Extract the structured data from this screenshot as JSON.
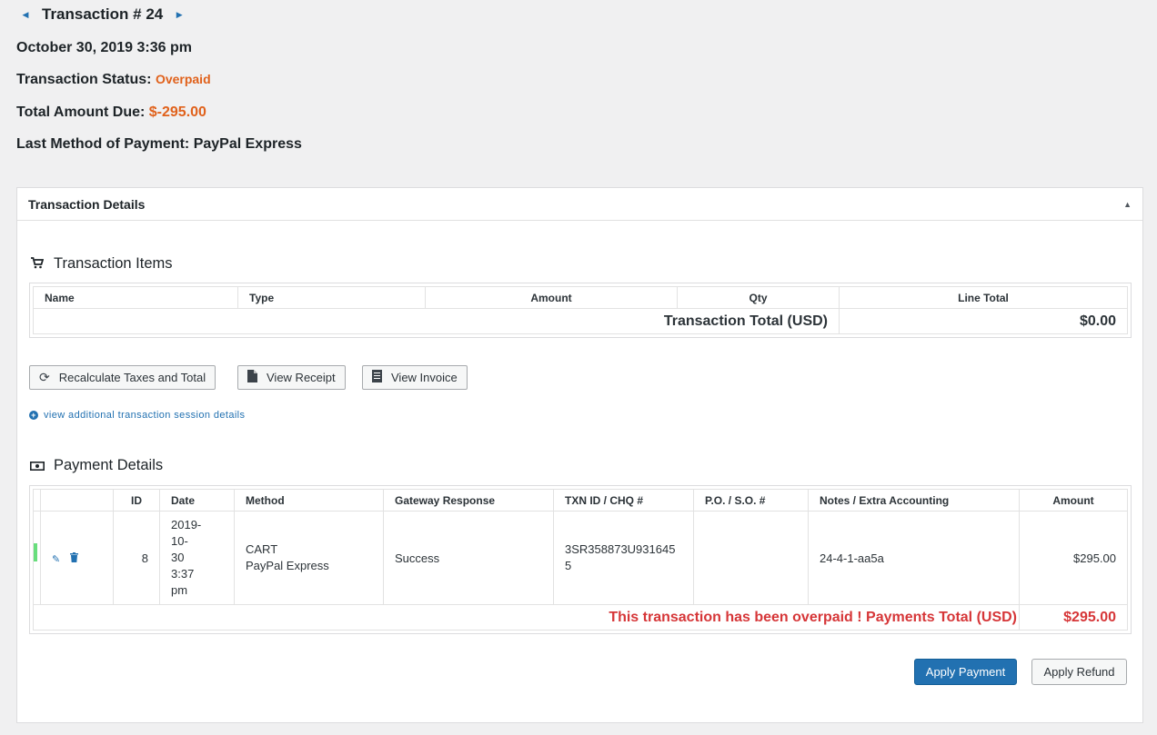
{
  "header": {
    "prev_icon": "triangle-left-icon",
    "next_icon": "triangle-right-icon",
    "title": "Transaction # 24",
    "date": "October 30, 2019 3:36 pm",
    "status_label": "Transaction Status:",
    "status_value": "Overpaid",
    "due_label": "Total Amount Due:",
    "due_value": "$-295.00",
    "method_label": "Last Method of Payment:",
    "method_value": "PayPal Express"
  },
  "panel": {
    "title": "Transaction Details",
    "collapse_icon": "triangle-up-icon"
  },
  "items": {
    "heading": "Transaction Items",
    "heading_icon": "cart-icon",
    "columns": [
      "Name",
      "Type",
      "Amount",
      "Qty",
      "Line Total"
    ],
    "total_label": "Transaction Total (USD)",
    "total_value": "$0.00"
  },
  "buttons": {
    "recalculate": "Recalculate Taxes and Total",
    "view_receipt": "View Receipt",
    "view_invoice": "View Invoice",
    "additional_link": "view additional transaction session details"
  },
  "payments": {
    "heading": "Payment Details",
    "heading_icon": "money-icon",
    "columns": [
      "ID",
      "Date",
      "Method",
      "Gateway Response",
      "TXN ID / CHQ #",
      "P.O. / S.O. #",
      "Notes / Extra Accounting",
      "Amount"
    ],
    "rows": [
      {
        "id": "8",
        "date": "2019-\n10-\n30\n3:37\npm",
        "method_line1": "CART",
        "method_line2": "PayPal Express",
        "gateway": "Success",
        "txn": "3SR358873U931645\n5",
        "po": "",
        "notes": "24-4-1-aa5a",
        "amount": "$295.00"
      }
    ],
    "overpaid_msg": "This transaction has been overpaid ! Payments Total (USD)",
    "total_value": "$295.00"
  },
  "actions": {
    "apply_payment": "Apply Payment",
    "apply_refund": "Apply Refund"
  }
}
